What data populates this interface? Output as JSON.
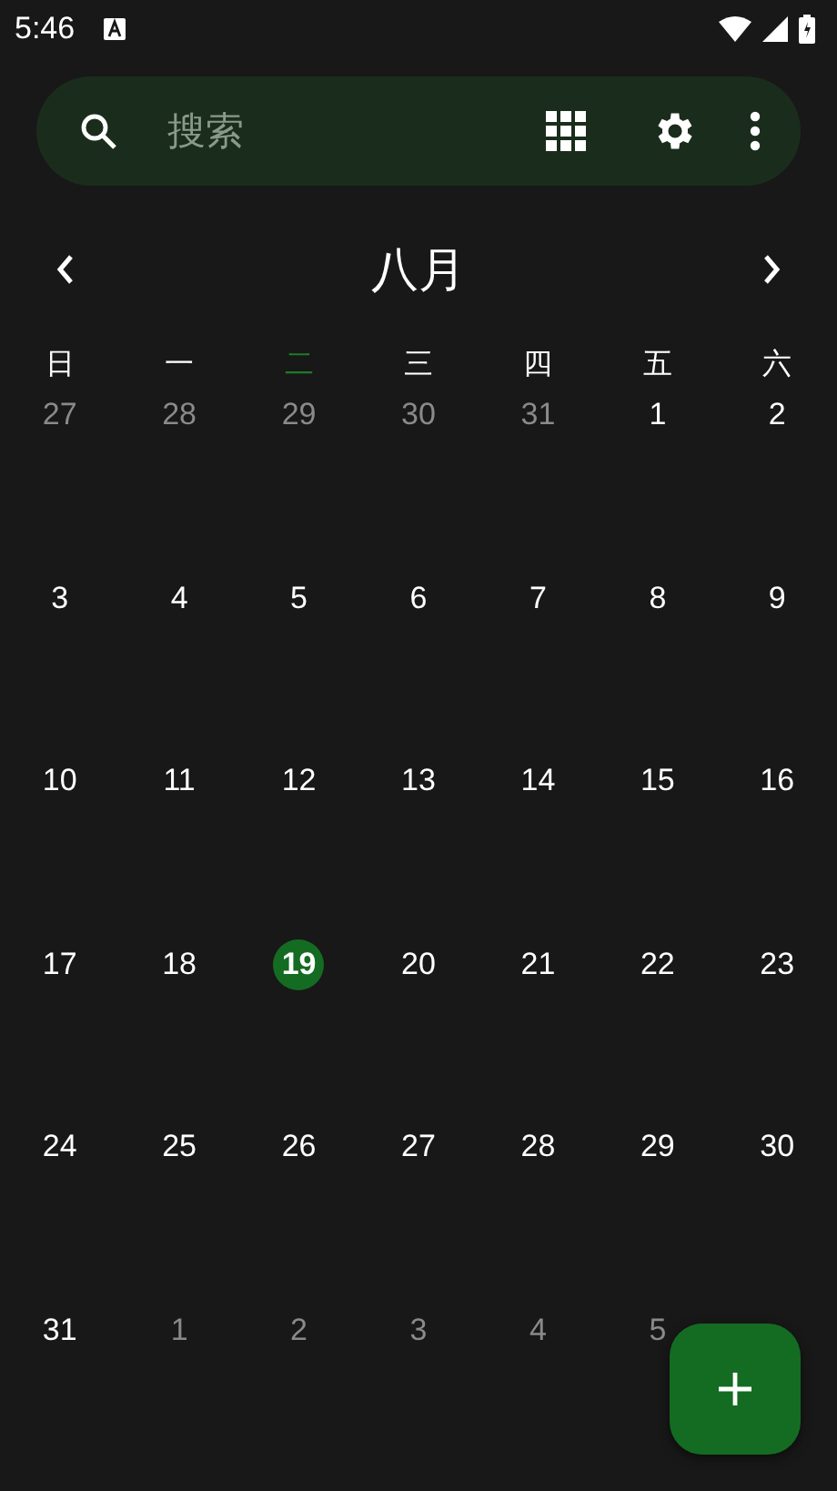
{
  "status_bar": {
    "time": "5:46"
  },
  "search": {
    "placeholder": "搜索"
  },
  "month": {
    "title": "八月"
  },
  "weekdays": [
    {
      "label": "日",
      "selected": false
    },
    {
      "label": "一",
      "selected": false
    },
    {
      "label": "二",
      "selected": true
    },
    {
      "label": "三",
      "selected": false
    },
    {
      "label": "四",
      "selected": false
    },
    {
      "label": "五",
      "selected": false
    },
    {
      "label": "六",
      "selected": false
    }
  ],
  "weeks": [
    [
      {
        "day": "27",
        "muted": true,
        "selected": false
      },
      {
        "day": "28",
        "muted": true,
        "selected": false
      },
      {
        "day": "29",
        "muted": true,
        "selected": false
      },
      {
        "day": "30",
        "muted": true,
        "selected": false
      },
      {
        "day": "31",
        "muted": true,
        "selected": false
      },
      {
        "day": "1",
        "muted": false,
        "selected": false
      },
      {
        "day": "2",
        "muted": false,
        "selected": false
      }
    ],
    [
      {
        "day": "3",
        "muted": false,
        "selected": false
      },
      {
        "day": "4",
        "muted": false,
        "selected": false
      },
      {
        "day": "5",
        "muted": false,
        "selected": false
      },
      {
        "day": "6",
        "muted": false,
        "selected": false
      },
      {
        "day": "7",
        "muted": false,
        "selected": false
      },
      {
        "day": "8",
        "muted": false,
        "selected": false
      },
      {
        "day": "9",
        "muted": false,
        "selected": false
      }
    ],
    [
      {
        "day": "10",
        "muted": false,
        "selected": false
      },
      {
        "day": "11",
        "muted": false,
        "selected": false
      },
      {
        "day": "12",
        "muted": false,
        "selected": false
      },
      {
        "day": "13",
        "muted": false,
        "selected": false
      },
      {
        "day": "14",
        "muted": false,
        "selected": false
      },
      {
        "day": "15",
        "muted": false,
        "selected": false
      },
      {
        "day": "16",
        "muted": false,
        "selected": false
      }
    ],
    [
      {
        "day": "17",
        "muted": false,
        "selected": false
      },
      {
        "day": "18",
        "muted": false,
        "selected": false
      },
      {
        "day": "19",
        "muted": false,
        "selected": true
      },
      {
        "day": "20",
        "muted": false,
        "selected": false
      },
      {
        "day": "21",
        "muted": false,
        "selected": false
      },
      {
        "day": "22",
        "muted": false,
        "selected": false
      },
      {
        "day": "23",
        "muted": false,
        "selected": false
      }
    ],
    [
      {
        "day": "24",
        "muted": false,
        "selected": false
      },
      {
        "day": "25",
        "muted": false,
        "selected": false
      },
      {
        "day": "26",
        "muted": false,
        "selected": false
      },
      {
        "day": "27",
        "muted": false,
        "selected": false
      },
      {
        "day": "28",
        "muted": false,
        "selected": false
      },
      {
        "day": "29",
        "muted": false,
        "selected": false
      },
      {
        "day": "30",
        "muted": false,
        "selected": false
      }
    ],
    [
      {
        "day": "31",
        "muted": false,
        "selected": false
      },
      {
        "day": "1",
        "muted": true,
        "selected": false
      },
      {
        "day": "2",
        "muted": true,
        "selected": false
      },
      {
        "day": "3",
        "muted": true,
        "selected": false
      },
      {
        "day": "4",
        "muted": true,
        "selected": false
      },
      {
        "day": "5",
        "muted": true,
        "selected": false
      }
    ]
  ]
}
